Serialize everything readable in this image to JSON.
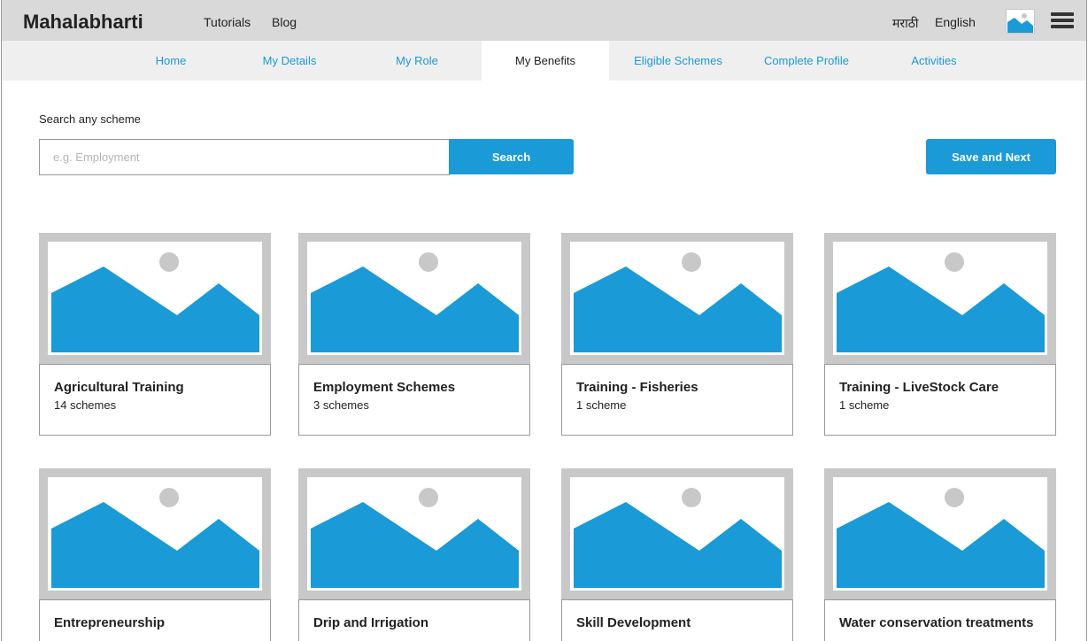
{
  "header": {
    "brand": "Mahalabharti",
    "links": [
      "Tutorials",
      "Blog"
    ],
    "languages": [
      "मराठी",
      "English"
    ]
  },
  "tabs": [
    {
      "label": "Home",
      "active": false
    },
    {
      "label": "My Details",
      "active": false
    },
    {
      "label": "My Role",
      "active": false
    },
    {
      "label": "My Benefits",
      "active": true
    },
    {
      "label": "Eligible Schemes",
      "active": false
    },
    {
      "label": "Complete Profile",
      "active": false
    },
    {
      "label": "Activities",
      "active": false
    }
  ],
  "search": {
    "label": "Search any scheme",
    "placeholder": "e.g. Employment",
    "value": "",
    "button_label": "Search"
  },
  "save_next_label": "Save and Next",
  "cards": [
    {
      "title": "Agricultural Training",
      "count": "14 schemes"
    },
    {
      "title": "Employment Schemes",
      "count": "3 schemes"
    },
    {
      "title": "Training - Fisheries",
      "count": "1 scheme"
    },
    {
      "title": "Training - LiveStock Care",
      "count": "1 scheme"
    },
    {
      "title": "Entrepreneurship",
      "count": ""
    },
    {
      "title": "Drip and Irrigation",
      "count": ""
    },
    {
      "title": "Skill Development",
      "count": ""
    },
    {
      "title": "Water conservation treatments",
      "count": ""
    }
  ],
  "colors": {
    "accent": "#1a9ad6",
    "topbar": "#d9d9d9",
    "subnav": "#efefef",
    "placeholder_frame": "#c8c8c8"
  },
  "icons": {
    "image_placeholder": "image-placeholder-icon",
    "menu": "hamburger-menu-icon",
    "avatar": "avatar-image-icon"
  }
}
